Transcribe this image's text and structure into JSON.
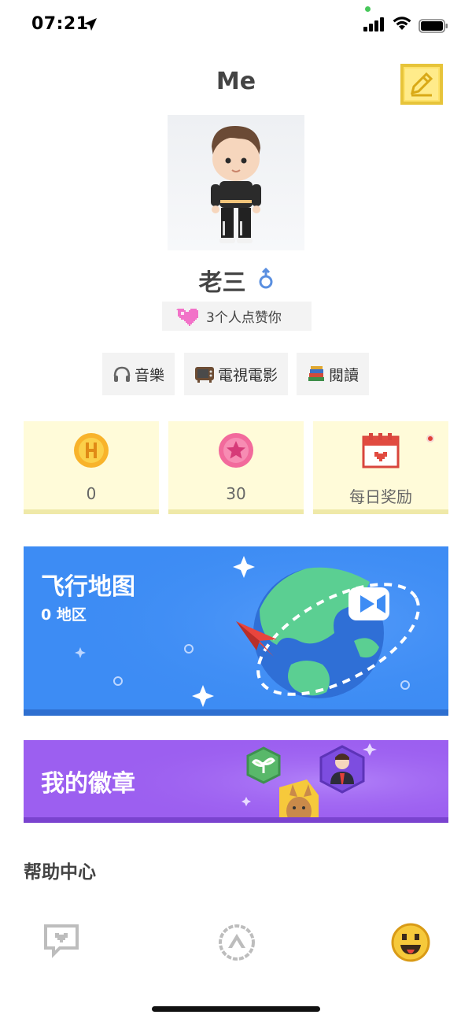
{
  "status": {
    "time": "07:21"
  },
  "header": {
    "title": "Me",
    "edit_icon": "pencil-edit-icon"
  },
  "profile": {
    "name": "老三",
    "gender_icon": "male-symbol-icon",
    "likes_count": "3",
    "likes_text": "个人点赞你"
  },
  "interests": [
    {
      "label": "音樂",
      "icon": "headphones-icon"
    },
    {
      "label": "電視電影",
      "icon": "tv-icon"
    },
    {
      "label": "閱讀",
      "icon": "books-icon"
    }
  ],
  "stats": [
    {
      "value": "0",
      "icon": "h-coin-icon"
    },
    {
      "value": "30",
      "icon": "star-coin-icon"
    },
    {
      "value": "每日奖励",
      "icon": "calendar-heart-icon"
    }
  ],
  "flight_map": {
    "title": "飞行地图",
    "subtitle": "0 地区"
  },
  "badges": {
    "title": "我的徽章"
  },
  "help": {
    "label": "帮助中心"
  },
  "tabbar": [
    {
      "icon": "chat-heart-icon"
    },
    {
      "icon": "plane-up-icon"
    },
    {
      "icon": "smiley-face-icon",
      "active": true
    }
  ],
  "colors": {
    "map_card": "#3d8cf4",
    "badge_card": "#9c5ff0",
    "stat_card": "#fffbd9",
    "accent_yellow": "#f6c93b"
  }
}
